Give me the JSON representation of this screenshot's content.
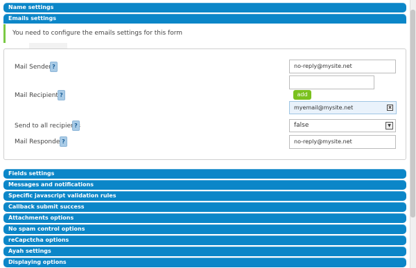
{
  "sections_top": [
    {
      "label": "Name settings"
    },
    {
      "label": "Emails settings"
    }
  ],
  "notice": "You need to configure the emails settings for this form",
  "form": {
    "mail_sender": {
      "label": "Mail Sender",
      "value": "no-reply@mysite.net"
    },
    "mail_recipients": {
      "label": "Mail Recipients",
      "value": "",
      "add_label": "add",
      "recipients": [
        "myemail@mysite.net"
      ]
    },
    "send_to_all": {
      "label": "Send to all recipients",
      "value": "false"
    },
    "mail_responder": {
      "label": "Mail Responder",
      "value": "no-reply@mysite.net"
    },
    "help_glyph": "?",
    "remove_glyph": "x"
  },
  "sections_bottom": [
    {
      "label": "Fields settings"
    },
    {
      "label": "Messages and notifications"
    },
    {
      "label": "Specific javascript validation rules"
    },
    {
      "label": "Callback submit success"
    },
    {
      "label": "Attachments options"
    },
    {
      "label": "No spam control options"
    },
    {
      "label": "reCapctcha options"
    },
    {
      "label": "Ayah settings"
    },
    {
      "label": "Displaying options"
    }
  ],
  "colors": {
    "accent": "#0b86c8",
    "add_button": "#7ac11e",
    "notice_border": "#7ac943"
  }
}
